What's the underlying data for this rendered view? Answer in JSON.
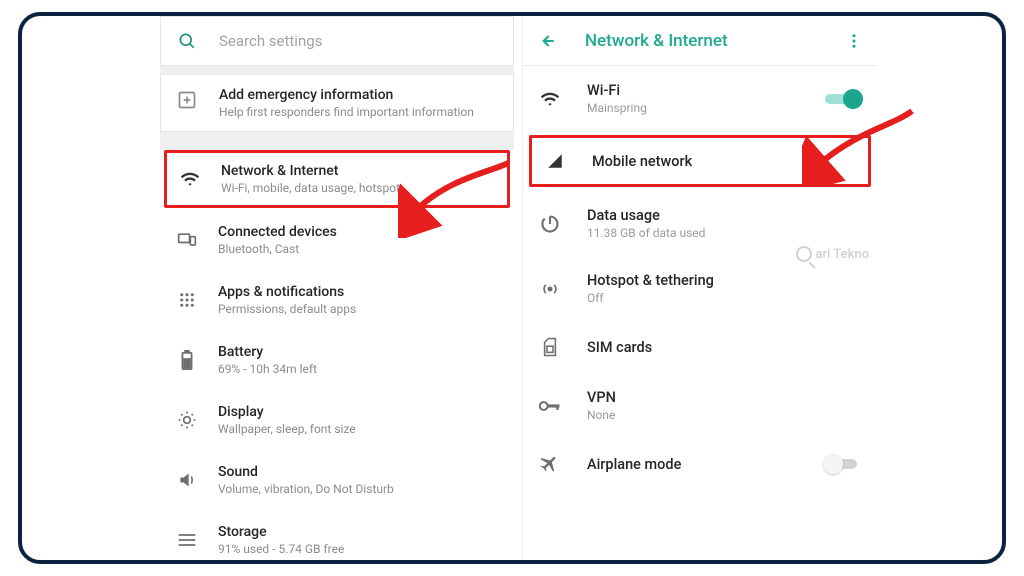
{
  "left": {
    "search_placeholder": "Search settings",
    "emergency": {
      "title": "Add emergency information",
      "sub": "Help first responders find important information"
    },
    "items": [
      {
        "icon": "wifi",
        "title": "Network & Internet",
        "sub": "Wi-Fi, mobile, data usage, hotspot",
        "highlight": true
      },
      {
        "icon": "devices",
        "title": "Connected devices",
        "sub": "Bluetooth, Cast"
      },
      {
        "icon": "apps",
        "title": "Apps & notifications",
        "sub": "Permissions, default apps"
      },
      {
        "icon": "battery",
        "title": "Battery",
        "sub": "69% - 10h 34m left"
      },
      {
        "icon": "display",
        "title": "Display",
        "sub": "Wallpaper, sleep, font size"
      },
      {
        "icon": "sound",
        "title": "Sound",
        "sub": "Volume, vibration, Do Not Disturb"
      },
      {
        "icon": "storage",
        "title": "Storage",
        "sub": "91% used - 5.74 GB free"
      }
    ]
  },
  "right": {
    "header_title": "Network & Internet",
    "items": [
      {
        "icon": "wifi",
        "title": "Wi-Fi",
        "sub": "Mainspring",
        "toggle": "on"
      },
      {
        "icon": "signal",
        "title": "Mobile network",
        "sub": "",
        "highlight": true
      },
      {
        "icon": "data",
        "title": "Data usage",
        "sub": "11.38 GB of data used"
      },
      {
        "icon": "hotspot",
        "title": "Hotspot & tethering",
        "sub": "Off"
      },
      {
        "icon": "sim",
        "title": "SIM cards",
        "sub": ""
      },
      {
        "icon": "vpn",
        "title": "VPN",
        "sub": "None"
      },
      {
        "icon": "plane",
        "title": "Airplane mode",
        "sub": "",
        "toggle": "off"
      }
    ]
  },
  "watermark": "ari Tekno",
  "colors": {
    "accent": "#1ea890",
    "highlight": "#e61e1e",
    "frame": "#0a2342"
  }
}
